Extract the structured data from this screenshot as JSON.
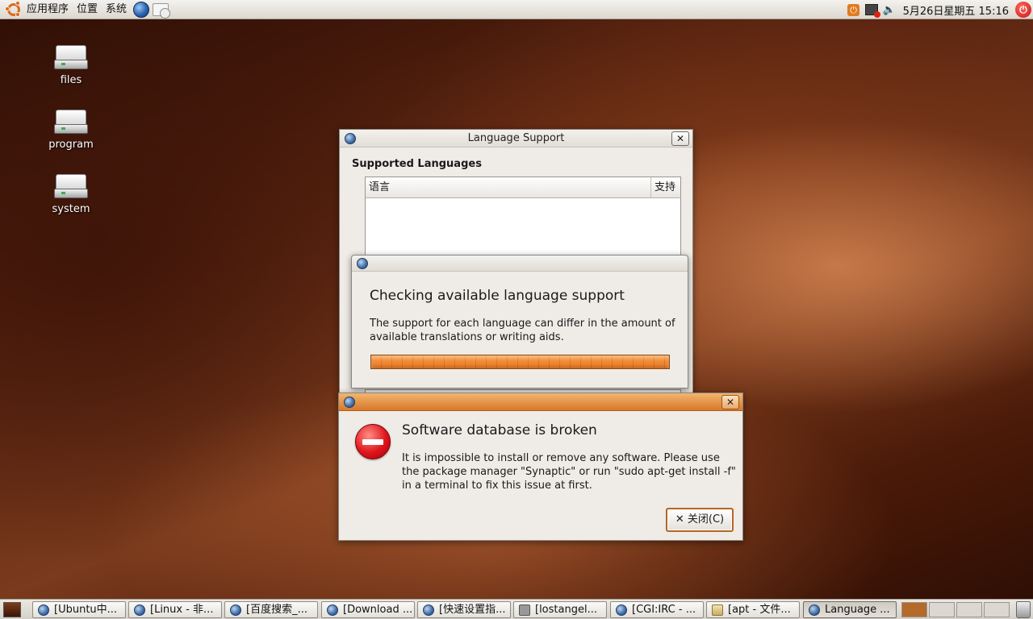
{
  "top_panel": {
    "menus": [
      "应用程序",
      "位置",
      "系统"
    ],
    "clock": "5月26日星期五 15:16"
  },
  "desktop_icons": [
    {
      "label": "files"
    },
    {
      "label": "program"
    },
    {
      "label": "system"
    }
  ],
  "language_support": {
    "title": "Language Support",
    "close_label": "✕",
    "section_title": "Supported Languages",
    "columns": [
      "语言",
      "支持"
    ]
  },
  "checking_dialog": {
    "heading": "Checking available language support",
    "body": "The support for each language can differ in the amount of available translations or writing aids.",
    "progress": 1.0
  },
  "error_dialog": {
    "close_label": "✕",
    "heading": "Software database is broken",
    "body_line1": "It is impossible to install or remove any software. Please use",
    "body_line2": "the package manager \"Synaptic\" or run \"sudo apt-get install -f\"",
    "body_line3": "in a terminal to fix this issue at first.",
    "button_label": "关闭(C)",
    "button_icon": "✕"
  },
  "taskbar": {
    "tasks": [
      {
        "label": "[Ubuntu中...",
        "icon": "globe"
      },
      {
        "label": "[Linux - 非...",
        "icon": "globe"
      },
      {
        "label": "[百度搜索_...",
        "icon": "globe"
      },
      {
        "label": "[Download ...",
        "icon": "globe"
      },
      {
        "label": "[快速设置指...",
        "icon": "globe"
      },
      {
        "label": "[lostangel...",
        "icon": "terminal"
      },
      {
        "label": "[CGI:IRC - ...",
        "icon": "globe"
      },
      {
        "label": "[apt - 文件...",
        "icon": "folder"
      },
      {
        "label": "Language ...",
        "icon": "globe",
        "active": true
      }
    ]
  },
  "colors": {
    "accent": "#e27a1f",
    "error": "#e0141c",
    "window_bg": "#efebe7"
  }
}
